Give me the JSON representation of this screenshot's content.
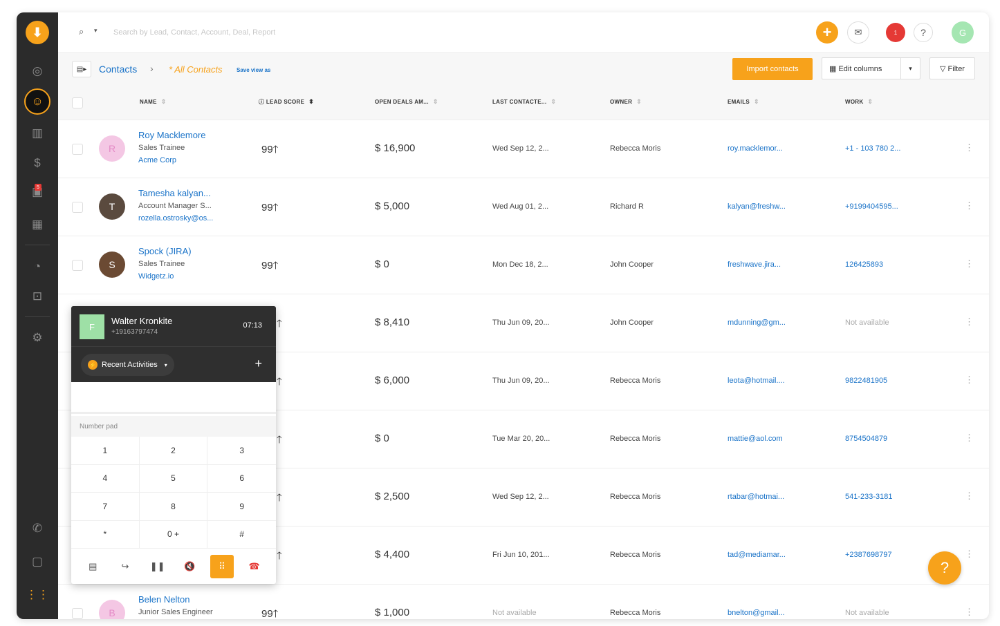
{
  "app": {
    "logo_glyph": "⬇",
    "accent": "#f7a21b"
  },
  "sidebar": {
    "items": [
      {
        "name": "nav-contacts-circle",
        "glyph": "◎"
      },
      {
        "name": "nav-contacts",
        "glyph": "☺"
      },
      {
        "name": "nav-accounts",
        "glyph": "▥"
      },
      {
        "name": "nav-deals",
        "glyph": "$"
      },
      {
        "name": "nav-inbox",
        "glyph": "▣",
        "badge": "5"
      },
      {
        "name": "nav-calendar",
        "glyph": "▦"
      },
      {
        "name": "nav-reports",
        "glyph": "◔"
      },
      {
        "name": "nav-campaigns",
        "glyph": "⊡"
      },
      {
        "name": "nav-settings",
        "glyph": "⚙"
      },
      {
        "name": "nav-phone",
        "glyph": "✆"
      },
      {
        "name": "nav-chat",
        "glyph": "▢"
      },
      {
        "name": "nav-apps",
        "glyph": "⋮⋮"
      }
    ]
  },
  "topbar": {
    "search_icon": "⌕",
    "search_caret": "▾",
    "search_placeholder": "Search by Lead, Contact, Account, Deal, Report",
    "add_glyph": "+",
    "mail_glyph": "✉",
    "notif_count": "1",
    "help_glyph": "?",
    "avatar_letter": "G"
  },
  "toolbar": {
    "toggle_glyph": "▤▸",
    "crumb_root": "Contacts",
    "crumb_sep": "›",
    "crumb_view": "* All Contacts",
    "save_view": "Save view as",
    "import_label": "Import contacts",
    "edit_columns_label": "▦ Edit columns",
    "edit_caret": "▾",
    "filter_label": "▽ Filter"
  },
  "table": {
    "headers": {
      "name": "NAME",
      "lead_score": "ⓘ LEAD SCORE",
      "open_deals": "OPEN DEALS AM...",
      "last_contacted": "LAST CONTACTE...",
      "owner": "OWNER",
      "emails": "EMAILS",
      "work": "WORK"
    },
    "sort_glyph": "⇕",
    "sort_active_glyph": "⬍",
    "rows": [
      {
        "name": "Roy Macklemore",
        "title": "Sales Trainee",
        "company": "Acme Corp",
        "avatar": "R",
        "score": "99🡑",
        "amount": "$ 16,900",
        "last": "Wed Sep 12, 2...",
        "owner": "Rebecca Moris",
        "email": "roy.macklemor...",
        "work": "+1 - 103 780 2...",
        "work_muted": false
      },
      {
        "name": "Tamesha kalyan...",
        "title": "Account Manager S...",
        "company": "rozella.ostrosky@os...",
        "avatar": "T",
        "score": "99🡑",
        "amount": "$ 5,000",
        "last": "Wed Aug 01, 2...",
        "owner": "Richard R",
        "email": "kalyan@freshw...",
        "work": "+9199404595...",
        "work_muted": false
      },
      {
        "name": "Spock (JIRA)",
        "title": "Sales Trainee",
        "company": "Widgetz.io",
        "avatar": "S",
        "score": "99🡑",
        "amount": "$ 0",
        "last": "Mon Dec 18, 2...",
        "owner": "John Cooper",
        "email": "freshwave.jira...",
        "work": "126425893",
        "work_muted": false
      },
      {
        "name": "",
        "title": "",
        "company": "",
        "avatar": "",
        "score": "🡑",
        "amount": "$ 8,410",
        "last": "Thu Jun 09, 20...",
        "owner": "John Cooper",
        "email": "mdunning@gm...",
        "work": "Not available",
        "work_muted": true
      },
      {
        "name": "",
        "title": "",
        "company": "",
        "avatar": "",
        "score": "🡑",
        "amount": "$ 6,000",
        "last": "Thu Jun 09, 20...",
        "owner": "Rebecca Moris",
        "email": "leota@hotmail....",
        "work": "9822481905",
        "work_muted": false
      },
      {
        "name": "",
        "title": "",
        "company": "",
        "avatar": "",
        "score": "🡑",
        "amount": "$ 0",
        "last": "Tue Mar 20, 20...",
        "owner": "Rebecca Moris",
        "email": "mattie@aol.com",
        "work": "8754504879",
        "work_muted": false
      },
      {
        "name": "",
        "title": "",
        "company": "",
        "avatar": "",
        "score": "🡑",
        "amount": "$ 2,500",
        "last": "Wed Sep 12, 2...",
        "owner": "Rebecca Moris",
        "email": "rtabar@hotmai...",
        "work": "541-233-3181",
        "work_muted": false
      },
      {
        "name": "",
        "title": "",
        "company": "",
        "avatar": "",
        "score": "🡑",
        "amount": "$ 4,400",
        "last": "Fri Jun 10, 201...",
        "owner": "Rebecca Moris",
        "email": "tad@mediamar...",
        "work": "+2387698797",
        "work_muted": false
      },
      {
        "name": "Belen Nelton",
        "title": "Junior Sales Engineer",
        "company": "",
        "avatar": "B",
        "score": "99🡑",
        "amount": "$ 1,000",
        "last": "Not available",
        "owner": "Rebecca Moris",
        "email": "bnelton@gmail...",
        "work": "Not available",
        "work_muted": true
      }
    ]
  },
  "dialer": {
    "avatar": "F",
    "name": "Walter Kronkite",
    "number": "+19163797474",
    "timer": "07:13",
    "recent_label": "Recent Activities",
    "recent_caret": "▾",
    "plus": "+",
    "numpad_label": "Number pad",
    "keys": [
      "1",
      "2",
      "3",
      "4",
      "5",
      "6",
      "7",
      "8",
      "9",
      "*",
      "0 +",
      "#"
    ],
    "actions": [
      "▤",
      "↪",
      "❚❚",
      "🔇",
      "⠿",
      "☎"
    ]
  },
  "help_fab": "?"
}
